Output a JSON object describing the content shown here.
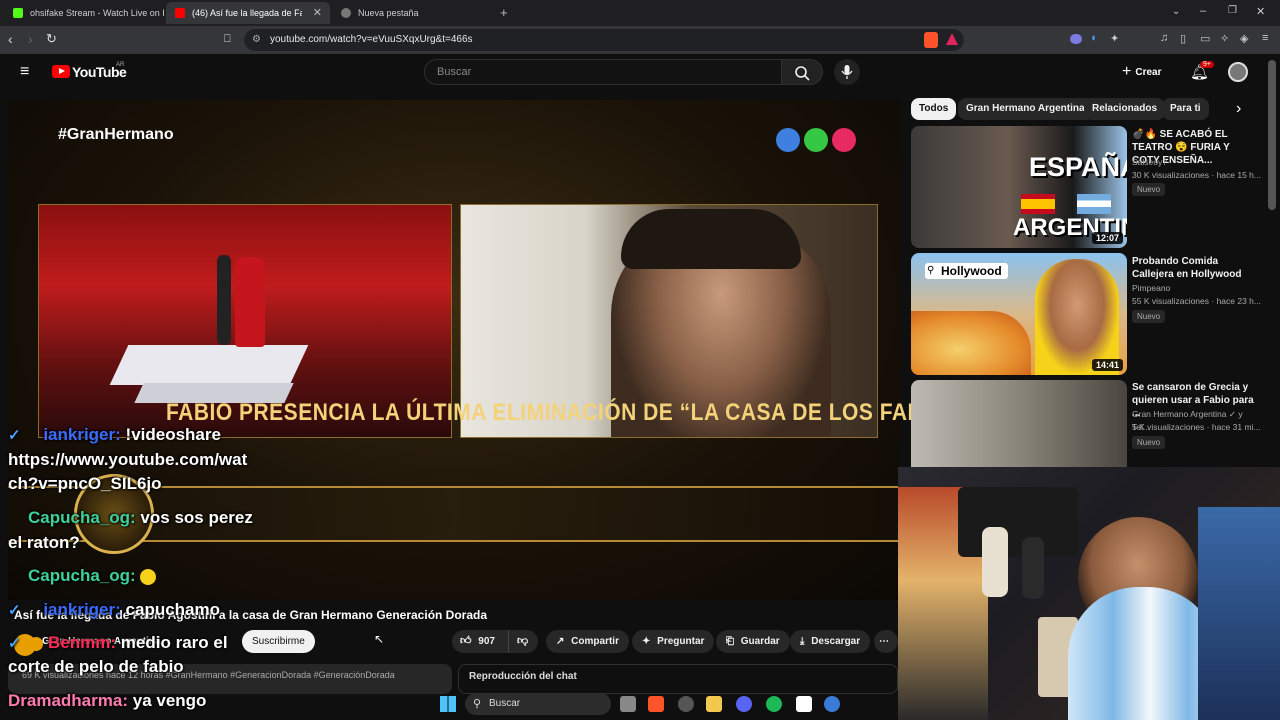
{
  "browser": {
    "tabs": [
      {
        "label": "ohsifake Stream - Watch Live on Kick"
      },
      {
        "label": "(46) Así fue la llegada de Fabio"
      },
      {
        "label": "Nueva pestaña"
      }
    ],
    "url": "youtube.com/watch?v=eVuuSXqxUrg&t=466s"
  },
  "youtube": {
    "logo_text": "YouTube",
    "region": "AR",
    "search_placeholder": "Buscar",
    "create_label": "Crear",
    "notifications_badge": "9+"
  },
  "video": {
    "hashtag_overlay": "#GranHermano",
    "banner_text": "FABIO PRESENCIA LA ÚLTIMA ELIMINACIÓN DE “LA CASA DE LOS FAMOSOS”",
    "title": "Así fue la llegada de Fabio Agostini a la casa de Gran Hermano Generación Dorada",
    "channel": "Gran Hermano Argentina",
    "subscribe_label": "Suscribirme",
    "likes": "907",
    "share_label": "Compartir",
    "ask_label": "Preguntar",
    "save_label": "Guardar",
    "download_label": "Descargar",
    "description": "69 K visualizaciones  hace 12 horas  #GranHermano #GeneracionDorada #GeneraciónDorada",
    "chat_replay_label": "Reproducción del chat"
  },
  "sidebar": {
    "chips": [
      {
        "label": "Todos"
      },
      {
        "label": "Gran Hermano Argentina"
      },
      {
        "label": "Relacionados"
      },
      {
        "label": "Para ti"
      }
    ],
    "videos": [
      {
        "title": "💣🔥 SE ACABÓ EL TEATRO 😵 FURIA Y COTY ENSEÑA...",
        "channel": "Salseoy?",
        "meta": "30 K visualizaciones · hace 15 h...",
        "badge": "Nuevo",
        "duration": "12:07",
        "thumb_text_1": "ESPAÑA",
        "thumb_text_2": "ARGENTINA"
      },
      {
        "title": "Probando Comida Callejera en Hollywood",
        "channel": "Pimpeano",
        "meta": "55 K visualizaciones · hace 23 h...",
        "badge": "Nuevo",
        "duration": "14:41",
        "thumb_text_1": "Hollywood"
      },
      {
        "title": "Se cansaron de Grecia y quieren usar a Fabio para ...",
        "channel": "Gran Hermano Argentina ✓ y Tel...",
        "meta": "5 K visualizaciones · hace 31 mi...",
        "badge": "Nuevo"
      }
    ]
  },
  "chat_overlay": [
    {
      "user": "iankriger:",
      "message": "!videoshare"
    },
    {
      "message": "https://www.youtube.com/wat"
    },
    {
      "message": "ch?v=pncO_SIL6jo"
    },
    {
      "user": "Capucha_og:",
      "message": "vos sos perez"
    },
    {
      "message": "el raton?"
    },
    {
      "user": "Capucha_og:",
      "message": ""
    },
    {
      "user": "iankriger:",
      "message": "capuchamo"
    },
    {
      "user": "Benmm:",
      "message": "medio raro el"
    },
    {
      "message": "corte de pelo de fabio"
    },
    {
      "user": "Dramadharma:",
      "message": "ya vengo"
    }
  ],
  "taskbar": {
    "search_label": "Buscar"
  },
  "colors": {
    "youtube_red": "#ff0000",
    "chat_blue": "#3b6cff",
    "chat_green": "#3ed19a",
    "chat_red": "#ff2a55",
    "banner_gold": "#f3d27a"
  },
  "icons": [
    "menu-icon",
    "search-icon",
    "mic-icon",
    "create-icon",
    "bell-icon",
    "like-icon",
    "dislike-icon",
    "share-icon",
    "ask-icon",
    "save-icon",
    "download-icon",
    "more-icon",
    "chevron-right-icon",
    "windows-start-icon"
  ]
}
